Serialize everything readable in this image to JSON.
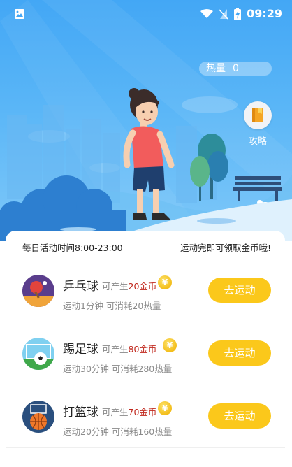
{
  "status_bar": {
    "time": "09:29"
  },
  "hero": {
    "heat_label": "热量",
    "heat_value": "0",
    "guide_label": "攻略"
  },
  "info": {
    "left": "每日活动时间8:00-23:00",
    "right": "运动完即可领取金币哦!"
  },
  "colors": {
    "hero_blue": "#43a7f5",
    "button_yellow": "#fbc81b",
    "highlight_red": "#c0261b"
  },
  "activities": [
    {
      "name": "乒乓球",
      "earn_prefix": "可产生",
      "earn_value": "20金币",
      "coin_symbol": "¥",
      "detail": "运动1分钟 可消耗20热量",
      "button": "去运动",
      "icon": "ping-pong-icon"
    },
    {
      "name": "踢足球",
      "earn_prefix": "可产生",
      "earn_value": "80金币",
      "coin_symbol": "¥",
      "detail": "运动30分钟 可消耗280热量",
      "button": "去运动",
      "icon": "soccer-icon"
    },
    {
      "name": "打篮球",
      "earn_prefix": "可产生",
      "earn_value": "70金币",
      "coin_symbol": "¥",
      "detail": "运动20分钟 可消耗160热量",
      "button": "去运动",
      "icon": "basketball-icon"
    }
  ]
}
